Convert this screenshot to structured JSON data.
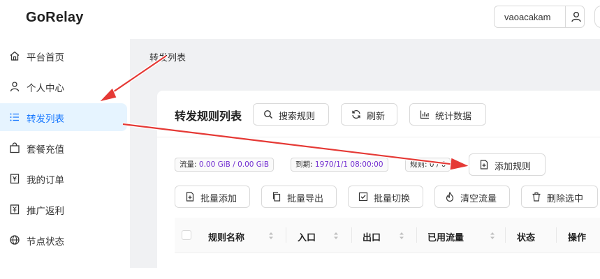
{
  "app": {
    "logo": "GoRelay",
    "username": "vaoacakam"
  },
  "sidebar": {
    "items": [
      {
        "label": "平台首页",
        "icon": "home-icon"
      },
      {
        "label": "个人中心",
        "icon": "user-icon"
      },
      {
        "label": "转发列表",
        "icon": "list-icon",
        "active": true
      },
      {
        "label": "套餐充值",
        "icon": "shopping-bag-icon"
      },
      {
        "label": "我的订单",
        "icon": "order-icon"
      },
      {
        "label": "推广返利",
        "icon": "rebate-icon"
      },
      {
        "label": "节点状态",
        "icon": "globe-icon"
      }
    ]
  },
  "breadcrumb": "转发列表",
  "card": {
    "title": "转发规则列表",
    "toolbar": {
      "search": "搜索规则",
      "refresh": "刷新",
      "stats": "统计数据"
    },
    "tags": {
      "traffic_label": "流量: ",
      "traffic_value": "0.00 GiB / 0.00 GiB",
      "expiry_label": "到期: ",
      "expiry_value": "1970/1/1 08:00:00",
      "rules_text": "规则: 0 / 0"
    },
    "add_rule": "添加规则",
    "batch": {
      "add": "批量添加",
      "export": "批量导出",
      "toggle": "批量切换",
      "clear_traffic": "清空流量",
      "delete_selected": "删除选中"
    },
    "table": {
      "columns": [
        "规则名称",
        "入口",
        "出口",
        "已用流量",
        "状态",
        "操作"
      ]
    }
  },
  "colors": {
    "accent": "#1677ff",
    "active_bg": "#e6f4ff",
    "tag_value": "#722ed1",
    "annotation": "#e53935"
  }
}
